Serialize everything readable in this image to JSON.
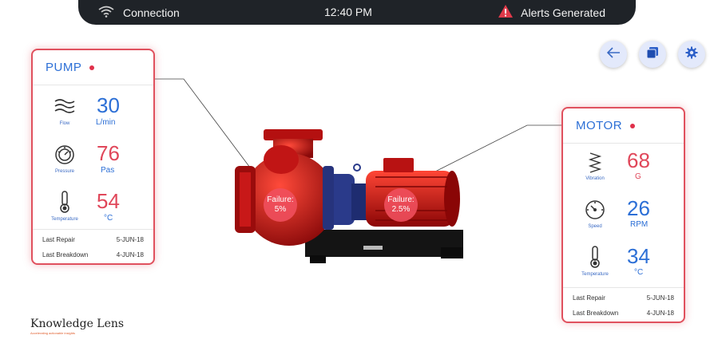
{
  "topbar": {
    "connection": "Connection",
    "time": "12:40 PM",
    "alerts": "Alerts Generated"
  },
  "toolbar": {
    "back_icon": "arrow-left-icon",
    "layers_icon": "layers-icon",
    "settings_icon": "gear-icon"
  },
  "pump": {
    "title": "PUMP",
    "metrics": [
      {
        "icon": "flow-waves-icon",
        "label": "Flow",
        "value": "30",
        "unit": "L/min",
        "color": "#2c6fd6"
      },
      {
        "icon": "pressure-gauge-icon",
        "label": "Pressure",
        "value": "76",
        "unit": "Pas",
        "color": "#e0475a"
      },
      {
        "icon": "thermometer-icon",
        "label": "Temperature",
        "value": "54",
        "unit": "°C",
        "color": "#e0475a"
      }
    ],
    "last_repair_label": "Last Repair",
    "last_repair": "5-JUN-18",
    "last_breakdown_label": "Last Breakdown",
    "last_breakdown": "4-JUN-18"
  },
  "motor": {
    "title": "MOTOR",
    "metrics": [
      {
        "icon": "vibration-icon",
        "label": "Vibration",
        "value": "68",
        "unit": "G",
        "color": "#e0475a"
      },
      {
        "icon": "speedometer-icon",
        "label": "Speed",
        "value": "26",
        "unit": "RPM",
        "color": "#2c6fd6"
      },
      {
        "icon": "thermometer-icon",
        "label": "Temperature",
        "value": "34",
        "unit": "°C",
        "color": "#2c6fd6"
      }
    ],
    "last_repair_label": "Last Repair",
    "last_repair": "5-JUN-18",
    "last_breakdown_label": "Last Breakdown",
    "last_breakdown": "4-JUN-18"
  },
  "failures": {
    "pump": {
      "label": "Failure:",
      "value": "5%"
    },
    "motor": {
      "label": "Failure:",
      "value": "2.5%"
    }
  },
  "logo": {
    "name": "Knowledge Lens",
    "tagline": "Accelerating actionable insights"
  },
  "colors": {
    "accent_red": "#e0475a",
    "accent_blue": "#2c6fd6",
    "topbar": "#1f2328"
  }
}
